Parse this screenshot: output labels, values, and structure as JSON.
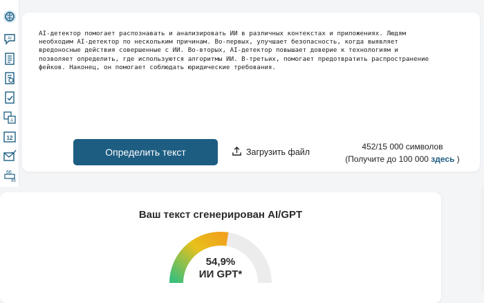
{
  "sidebar": {
    "items": [
      {
        "icon": "brain-logo-icon"
      },
      {
        "icon": "ai-chat-icon"
      },
      {
        "icon": "document-list-icon"
      },
      {
        "icon": "document-check-icon"
      },
      {
        "icon": "translate-icon"
      },
      {
        "icon": "numbers-icon"
      },
      {
        "icon": "mail-check-icon"
      },
      {
        "icon": "quote-icon"
      }
    ]
  },
  "input": {
    "text": "AI-детектор помогает распознавать и анализировать ИИ в различных контекстах и приложениях. Людям\nнеобходим AI-детектор по нескольким причинам. Во-первых, улучшает безопасность, когда выявляет\nвредоносные действия совершенные с ИИ. Во-вторых, AI-детектор повышает доверие к технологиям и\nпозволяет определить, где используются алгоритмы ИИ. В-третьих, помогает предотвратить распространение\nфейков. Наконец, он помогает соблюдать юридические требования."
  },
  "actions": {
    "detect_label": "Определить текст",
    "upload_label": "Загрузить файл"
  },
  "counter": {
    "count": "452/15 000 символов",
    "upsell_prefix": "(Получите до 100 000",
    "upsell_link": "здесь",
    "upsell_suffix": ")"
  },
  "result": {
    "title": "Ваш текст сгенерирован AI/GPT",
    "percent_label": "54,9%",
    "percent_value": 54.9,
    "type_label": "ИИ GPT*"
  },
  "colors": {
    "accent": "#1d5d82",
    "gauge_start": "#3bbf7a",
    "gauge_mid": "#e8c01c",
    "gauge_end": "#f0a21c",
    "gauge_track": "#ececec"
  }
}
